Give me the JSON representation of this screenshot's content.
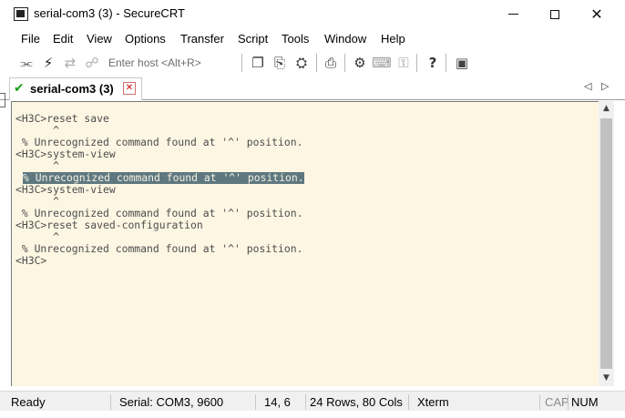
{
  "window": {
    "title": "serial-com3 (3) - SecureCRT",
    "icon": "securecrt-icon",
    "controls": {
      "minimize_icon": "minimize-icon",
      "maximize_icon": "maximize-icon",
      "close_glyph": "✕"
    }
  },
  "menu": {
    "items": [
      "File",
      "Edit",
      "View",
      "Options",
      "Transfer",
      "Script",
      "Tools",
      "Window",
      "Help"
    ]
  },
  "toolbar": {
    "host_placeholder": "Enter host <Alt+R>",
    "icons": {
      "connect": "⫘",
      "quick_connect": "⚡",
      "reconnect": "⇄",
      "disconnect": "☍",
      "copy": "❐",
      "paste": "⎘",
      "find": "⛭",
      "print": "⎙",
      "settings": "⚙",
      "keymap": "⌨",
      "sftp": "⚿",
      "help": "?",
      "about": "▣"
    }
  },
  "tab": {
    "check": "✔",
    "label": "serial-com3 (3)",
    "close": "✕",
    "nav_prev": "◁",
    "nav_next": "▷"
  },
  "terminal": {
    "lines": [
      "<H3C>reset save",
      "      ^",
      " % Unrecognized command found at '^' position.",
      "<H3C>system-view",
      "      ^",
      " % Unrecognized command found at '^' position.",
      "<H3C>system-view",
      "      ^",
      " % Unrecognized command found at '^' position.",
      "<H3C>reset saved-configuration",
      "      ^",
      " % Unrecognized command found at '^' position.",
      "<H3C>"
    ],
    "selected_line_index": 5,
    "background": "#fdf6e3",
    "foreground": "#4d4d4d",
    "selection_color": "#5f7880"
  },
  "scrollbar": {
    "up": "▲",
    "down": "▼"
  },
  "status": {
    "ready": "Ready",
    "serial": "Serial: COM3, 9600",
    "cursor": "14,   6",
    "size": "24 Rows, 80 Cols",
    "emulation": "Xterm",
    "cap": "CAP",
    "num": "NUM"
  }
}
